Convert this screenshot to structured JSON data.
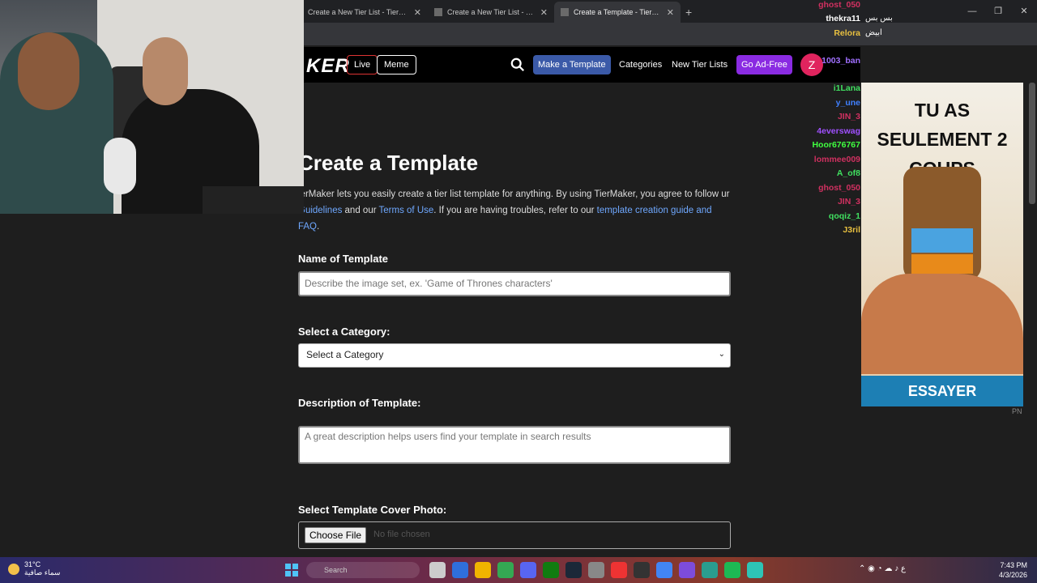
{
  "browser": {
    "tabs": [
      {
        "title": "Create a New Tier List - TierMaker"
      },
      {
        "title": "Create a New Tier List - TierMaker"
      },
      {
        "title": "Create a Template - TierMaker"
      }
    ],
    "new_tab": "+",
    "window_controls": [
      "—",
      "❐",
      "✕"
    ]
  },
  "site": {
    "logo": "KER",
    "nav": {
      "live": "Live",
      "meme": "Meme",
      "make_template": "Make a Template",
      "categories": "Categories",
      "new_tier_lists": "New Tier Lists",
      "go_ad_free": "Go Ad-Free",
      "avatar_letter": "Z"
    }
  },
  "page": {
    "title": "Create a Template",
    "intro": {
      "part1": "ierMaker lets you easily create a tier list template for anything. By using TierMaker, you agree to follow ur ",
      "guidelines": "Guidelines",
      "part2": " and our ",
      "terms": "Terms of Use",
      "part3": ". If you are having troubles, refer to our ",
      "guide": "template creation guide and FAQ",
      "part4": "."
    },
    "name_label": "Name of Template",
    "name_placeholder": "Describe the image set, ex. 'Game of Thrones characters'",
    "category_label": "Select a Category:",
    "category_selected": "Select a Category",
    "description_label": "Description of Template:",
    "description_placeholder": "A great description helps users find your template in search results",
    "cover_label": "Select Template Cover Photo:",
    "choose_file": "Choose File",
    "no_file": "No file chosen"
  },
  "chat": {
    "users": [
      {
        "name": "ghost_050",
        "color": "#d03060"
      },
      {
        "name": "thekra11",
        "color": "#ffffff"
      },
      {
        "name": "Relora",
        "color": "#e8c040"
      },
      {
        "name": "1003_ban",
        "color": "#a070ff"
      },
      {
        "name": "i1Lana",
        "color": "#40e060"
      },
      {
        "name": "y_une",
        "color": "#4080ff"
      },
      {
        "name": "JIN_3",
        "color": "#d03060"
      },
      {
        "name": "4everswag",
        "color": "#a050ff"
      },
      {
        "name": "Hoor676767",
        "color": "#40ff40"
      },
      {
        "name": "lommee009",
        "color": "#d03060"
      },
      {
        "name": "A_of8",
        "color": "#40e060"
      },
      {
        "name": "ghost_050",
        "color": "#d03060"
      },
      {
        "name": "JIN_3",
        "color": "#d03060"
      },
      {
        "name": "qoqiz_1",
        "color": "#40e060"
      },
      {
        "name": "J3ril",
        "color": "#e8c040"
      }
    ],
    "top_messages": [
      "بس بس",
      "ابيض"
    ]
  },
  "ad": {
    "headline": "TU AS SEULEMENT 2 COUPS",
    "cta": "ESSAYER",
    "tag": "PN"
  },
  "taskbar": {
    "temp": "31°C",
    "weather": "سماء صافية",
    "search": "Search",
    "time": "7:43 PM",
    "date": "4/3/2026",
    "lang": "ع"
  },
  "colors": {
    "accent_blue": "#3b5aa8",
    "ad_free_purple": "#8a2be2",
    "avatar_pink": "#e0245e",
    "link_blue": "#6fa8ff"
  }
}
